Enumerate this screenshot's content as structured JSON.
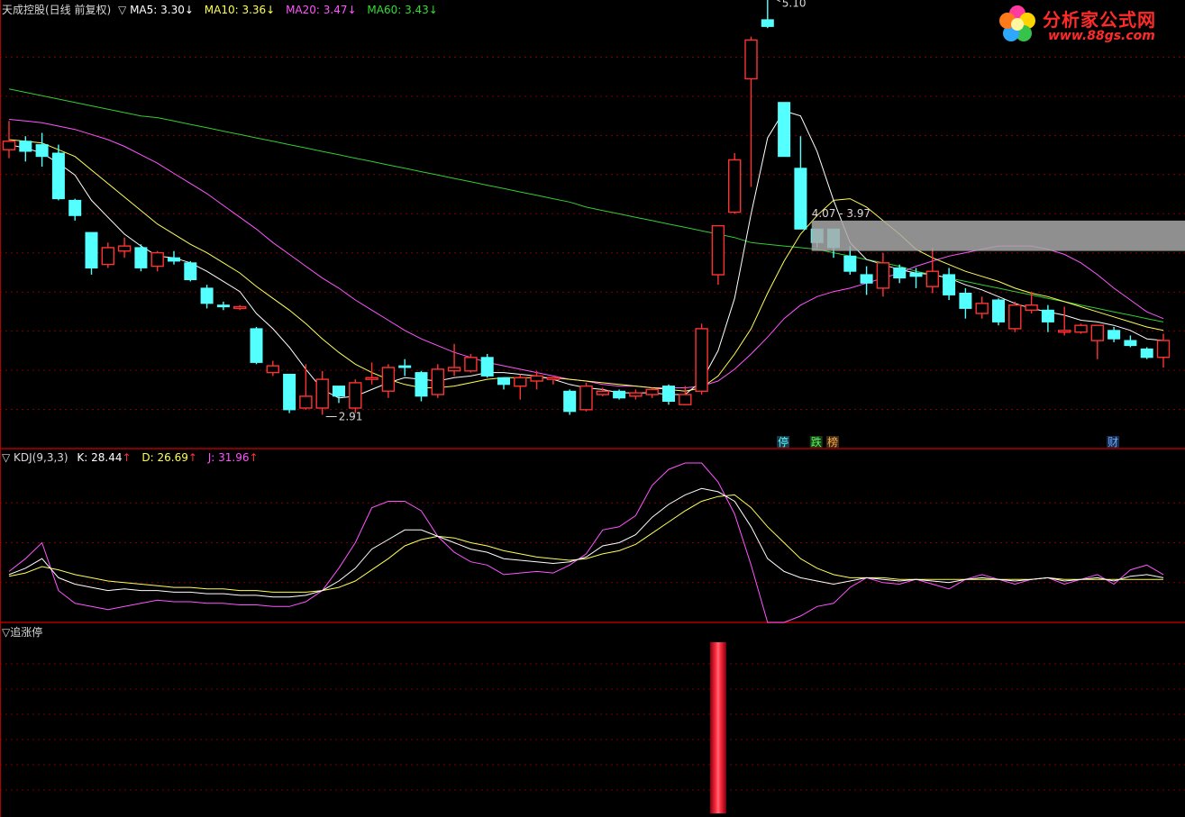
{
  "header": {
    "stock_name": "天成控股(日线 前复权)",
    "ma_prefix": "▽",
    "ma5": "MA5: 3.30",
    "ma10": "MA10: 3.36",
    "ma20": "MA20: 3.47",
    "ma60": "MA60: 3.43",
    "arrow_down": "↓"
  },
  "logo": {
    "title": "分析家公式网",
    "url": "www.88gs.com"
  },
  "kdj_header": {
    "title": "▽ KDJ(9,3,3)",
    "k": "K: 28.44",
    "d": "D: 26.69",
    "j": "J: 31.96",
    "arrow_up": "↑"
  },
  "indicator_header": {
    "title": "▽追涨停"
  },
  "colors": {
    "up": "#ff3232",
    "down": "#54ffff",
    "ma5": "#ffffff",
    "ma10": "#ffff55",
    "ma20": "#ff55ff",
    "ma60": "#33cc33",
    "grid": "#7a0000",
    "divider": "#b00000",
    "range_box": "#a8a8a8"
  },
  "chart_data": {
    "type": "candlestick",
    "ylim": [
      2.75,
      5.3
    ],
    "annotations": {
      "high": "5.10",
      "low": "2.91",
      "range": "4.07 - 3.97",
      "tag_ting": "停",
      "tag_die": "跌",
      "tag_bang": "榜",
      "tag_cai": "财"
    },
    "candles": [
      [
        4.52,
        4.57,
        4.69,
        4.47
      ],
      [
        4.57,
        4.51,
        4.6,
        4.45
      ],
      [
        4.55,
        4.48,
        4.62,
        4.42
      ],
      [
        4.5,
        4.23,
        4.55,
        4.22
      ],
      [
        4.22,
        4.13,
        4.23,
        4.1
      ],
      [
        4.03,
        3.82,
        4.03,
        3.78
      ],
      [
        3.84,
        3.94,
        3.97,
        3.82
      ],
      [
        3.92,
        3.95,
        4.0,
        3.88
      ],
      [
        3.94,
        3.82,
        3.96,
        3.8
      ],
      [
        3.83,
        3.91,
        3.92,
        3.8
      ],
      [
        3.88,
        3.86,
        3.92,
        3.84
      ],
      [
        3.85,
        3.75,
        3.86,
        3.74
      ],
      [
        3.7,
        3.61,
        3.72,
        3.58
      ],
      [
        3.6,
        3.59,
        3.62,
        3.57
      ],
      [
        3.58,
        3.59,
        3.6,
        3.57
      ],
      [
        3.46,
        3.26,
        3.47,
        3.25
      ],
      [
        3.2,
        3.24,
        3.27,
        3.18
      ],
      [
        3.19,
        2.98,
        3.19,
        2.96
      ],
      [
        2.99,
        3.06,
        3.25,
        2.98
      ],
      [
        2.99,
        3.16,
        3.21,
        2.95
      ],
      [
        3.12,
        3.06,
        3.12,
        3.02
      ],
      [
        2.99,
        3.14,
        3.16,
        2.96
      ],
      [
        3.16,
        3.17,
        3.26,
        3.13
      ],
      [
        3.09,
        3.23,
        3.25,
        3.05
      ],
      [
        3.24,
        3.23,
        3.28,
        3.18
      ],
      [
        3.2,
        3.06,
        3.21,
        3.03
      ],
      [
        3.07,
        3.22,
        3.25,
        3.05
      ],
      [
        3.21,
        3.23,
        3.37,
        3.18
      ],
      [
        3.21,
        3.29,
        3.31,
        3.2
      ],
      [
        3.29,
        3.18,
        3.31,
        3.17
      ],
      [
        3.17,
        3.13,
        3.17,
        3.1
      ],
      [
        3.12,
        3.17,
        3.19,
        3.04
      ],
      [
        3.15,
        3.18,
        3.21,
        3.1
      ],
      [
        3.16,
        3.17,
        3.17,
        3.13
      ],
      [
        3.09,
        2.97,
        3.1,
        2.95
      ],
      [
        2.98,
        3.12,
        3.14,
        2.97
      ],
      [
        3.07,
        3.09,
        3.11,
        3.06
      ],
      [
        3.09,
        3.05,
        3.1,
        3.04
      ],
      [
        3.06,
        3.08,
        3.1,
        3.04
      ],
      [
        3.07,
        3.1,
        3.11,
        3.05
      ],
      [
        3.12,
        3.03,
        3.13,
        3.01
      ],
      [
        3.01,
        3.07,
        3.12,
        3.01
      ],
      [
        3.09,
        3.46,
        3.49,
        3.07
      ],
      [
        3.78,
        4.07,
        4.07,
        3.72
      ],
      [
        4.15,
        4.46,
        4.5,
        4.14
      ],
      [
        4.94,
        5.17,
        5.19,
        4.3
      ],
      [
        5.29,
        5.25,
        5.43,
        5.24
      ],
      [
        4.8,
        4.48,
        4.8,
        4.49
      ],
      [
        4.41,
        4.05,
        4.6,
        4.05
      ],
      [
        4.05,
        3.97,
        4.05,
        3.94
      ],
      [
        4.05,
        3.94,
        4.05,
        3.88
      ],
      [
        3.89,
        3.8,
        3.95,
        3.78
      ],
      [
        3.78,
        3.73,
        3.83,
        3.66
      ],
      [
        3.7,
        3.85,
        3.91,
        3.65
      ],
      [
        3.82,
        3.76,
        3.84,
        3.73
      ],
      [
        3.79,
        3.77,
        3.82,
        3.7
      ],
      [
        3.71,
        3.8,
        3.94,
        3.67
      ],
      [
        3.78,
        3.66,
        3.82,
        3.63
      ],
      [
        3.67,
        3.58,
        3.7,
        3.52
      ],
      [
        3.55,
        3.61,
        3.65,
        3.52
      ],
      [
        3.63,
        3.5,
        3.64,
        3.48
      ],
      [
        3.46,
        3.6,
        3.62,
        3.44
      ],
      [
        3.57,
        3.6,
        3.68,
        3.55
      ],
      [
        3.57,
        3.5,
        3.6,
        3.44
      ],
      [
        3.44,
        3.45,
        3.59,
        3.42
      ],
      [
        3.44,
        3.48,
        3.49,
        3.43
      ],
      [
        3.39,
        3.48,
        3.48,
        3.28
      ],
      [
        3.45,
        3.4,
        3.47,
        3.38
      ],
      [
        3.39,
        3.36,
        3.42,
        3.35
      ],
      [
        3.34,
        3.29,
        3.35,
        3.28
      ],
      [
        3.29,
        3.39,
        3.43,
        3.23
      ]
    ],
    "ma5": [
      4.55,
      4.53,
      4.5,
      4.44,
      4.37,
      4.22,
      4.12,
      4.02,
      3.95,
      3.89,
      3.88,
      3.85,
      3.8,
      3.74,
      3.68,
      3.55,
      3.46,
      3.35,
      3.22,
      3.1,
      3.05,
      3.06,
      3.1,
      3.14,
      3.17,
      3.16,
      3.15,
      3.17,
      3.18,
      3.2,
      3.2,
      3.19,
      3.18,
      3.16,
      3.13,
      3.11,
      3.1,
      3.08,
      3.08,
      3.08,
      3.07,
      3.07,
      3.15,
      3.33,
      3.64,
      4.14,
      4.59,
      4.75,
      4.72,
      4.51,
      4.22,
      3.97,
      3.87,
      3.84,
      3.81,
      3.79,
      3.78,
      3.76,
      3.72,
      3.69,
      3.65,
      3.61,
      3.58,
      3.56,
      3.54,
      3.51,
      3.5,
      3.48,
      3.45,
      3.4,
      3.39
    ],
    "ma10": [
      4.58,
      4.57,
      4.56,
      4.52,
      4.48,
      4.4,
      4.32,
      4.24,
      4.16,
      4.08,
      4.02,
      3.96,
      3.91,
      3.85,
      3.79,
      3.71,
      3.64,
      3.57,
      3.49,
      3.4,
      3.32,
      3.25,
      3.2,
      3.16,
      3.13,
      3.11,
      3.11,
      3.12,
      3.14,
      3.16,
      3.17,
      3.17,
      3.17,
      3.17,
      3.16,
      3.15,
      3.14,
      3.13,
      3.12,
      3.11,
      3.1,
      3.09,
      3.11,
      3.18,
      3.31,
      3.46,
      3.67,
      3.86,
      4.02,
      4.13,
      4.22,
      4.23,
      4.18,
      4.1,
      4.02,
      3.93,
      3.88,
      3.84,
      3.8,
      3.77,
      3.74,
      3.7,
      3.67,
      3.65,
      3.62,
      3.59,
      3.56,
      3.53,
      3.5,
      3.47,
      3.45
    ],
    "ma20": [
      4.7,
      4.69,
      4.68,
      4.66,
      4.64,
      4.61,
      4.58,
      4.54,
      4.49,
      4.44,
      4.38,
      4.32,
      4.26,
      4.19,
      4.12,
      4.05,
      3.97,
      3.9,
      3.83,
      3.76,
      3.7,
      3.63,
      3.57,
      3.51,
      3.45,
      3.4,
      3.36,
      3.32,
      3.29,
      3.26,
      3.24,
      3.22,
      3.2,
      3.18,
      3.16,
      3.15,
      3.13,
      3.12,
      3.12,
      3.11,
      3.11,
      3.11,
      3.12,
      3.15,
      3.22,
      3.31,
      3.41,
      3.52,
      3.6,
      3.65,
      3.68,
      3.7,
      3.73,
      3.76,
      3.79,
      3.83,
      3.86,
      3.89,
      3.91,
      3.93,
      3.95,
      3.95,
      3.95,
      3.93,
      3.9,
      3.85,
      3.78,
      3.7,
      3.63,
      3.56,
      3.52
    ],
    "ma60": [
      4.88,
      4.86,
      4.84,
      4.82,
      4.8,
      4.78,
      4.76,
      4.74,
      4.72,
      4.71,
      4.69,
      4.67,
      4.65,
      4.63,
      4.61,
      4.59,
      4.57,
      4.55,
      4.53,
      4.51,
      4.49,
      4.47,
      4.45,
      4.43,
      4.41,
      4.39,
      4.37,
      4.35,
      4.33,
      4.31,
      4.29,
      4.27,
      4.25,
      4.23,
      4.21,
      4.18,
      4.16,
      4.14,
      4.12,
      4.1,
      4.08,
      4.06,
      4.04,
      4.02,
      4.0,
      3.97,
      3.96,
      3.95,
      3.94,
      3.93,
      3.91,
      3.89,
      3.87,
      3.85,
      3.83,
      3.8,
      3.78,
      3.76,
      3.74,
      3.72,
      3.7,
      3.68,
      3.66,
      3.64,
      3.62,
      3.6,
      3.58,
      3.56,
      3.54,
      3.52,
      3.5
    ],
    "kdj": {
      "ylim": [
        0,
        100
      ],
      "k": [
        30,
        34,
        40,
        28,
        24,
        22,
        20,
        21,
        20,
        20,
        19,
        19,
        18,
        18,
        17,
        17,
        16,
        16,
        17,
        20,
        26,
        34,
        46,
        52,
        58,
        58,
        54,
        50,
        46,
        44,
        40,
        39,
        38,
        37,
        38,
        41,
        48,
        50,
        55,
        66,
        74,
        80,
        84,
        82,
        76,
        60,
        40,
        32,
        28,
        26,
        24,
        26,
        28,
        27,
        26,
        27,
        26,
        25,
        27,
        28,
        27,
        26,
        27,
        28,
        26,
        27,
        28,
        26,
        29,
        30,
        28
      ],
      "d": [
        29,
        31,
        35,
        33,
        30,
        28,
        26,
        25,
        24,
        23,
        22,
        22,
        21,
        21,
        20,
        20,
        19,
        19,
        19,
        20,
        22,
        26,
        33,
        40,
        48,
        52,
        54,
        53,
        50,
        48,
        45,
        43,
        41,
        40,
        39,
        40,
        43,
        45,
        49,
        56,
        63,
        70,
        76,
        79,
        80,
        72,
        60,
        50,
        40,
        34,
        30,
        28,
        28,
        28,
        27,
        27,
        27,
        27,
        27,
        27,
        27,
        27,
        27,
        28,
        27,
        27,
        27,
        27,
        27,
        27,
        27
      ],
      "j": [
        32,
        40,
        50,
        20,
        12,
        10,
        8,
        10,
        12,
        14,
        13,
        13,
        12,
        12,
        11,
        11,
        10,
        10,
        13,
        20,
        34,
        50,
        72,
        76,
        76,
        70,
        54,
        44,
        38,
        36,
        30,
        31,
        32,
        31,
        36,
        43,
        58,
        60,
        67,
        86,
        96,
        100,
        100,
        88,
        68,
        36,
        0,
        0,
        4,
        10,
        12,
        22,
        28,
        25,
        24,
        27,
        24,
        21,
        27,
        30,
        27,
        24,
        27,
        28,
        24,
        27,
        30,
        24,
        33,
        36,
        30
      ]
    },
    "zhuizhangting": {
      "signal_index": 43
    }
  }
}
